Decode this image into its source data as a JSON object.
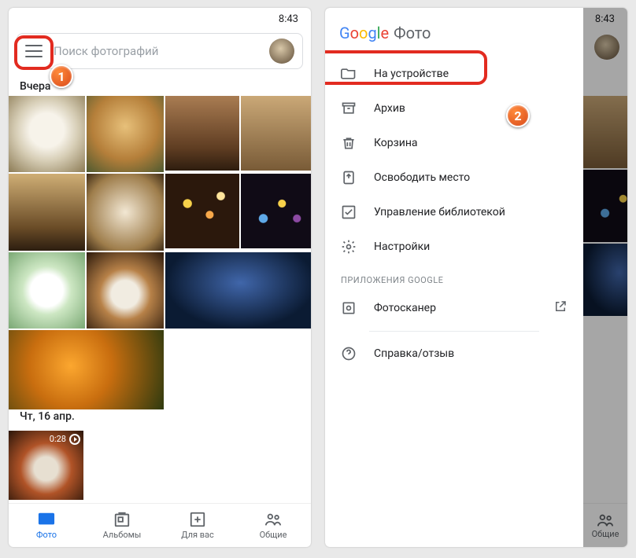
{
  "time": "8:43",
  "search": {
    "placeholder": "Поиск фотографий"
  },
  "sections": {
    "yesterday": "Вчера",
    "thu16": "Чт, 16 апр."
  },
  "video": {
    "duration": "0:28"
  },
  "tabs": {
    "photos": "Фото",
    "albums": "Альбомы",
    "foryou": "Для вас",
    "shared": "Общие"
  },
  "drawer": {
    "brand_word": "Фото",
    "items": {
      "device": "На устройстве",
      "archive": "Архив",
      "trash": "Корзина",
      "free": "Освободить место",
      "manage": "Управление библиотекой",
      "settings": "Настройки"
    },
    "apps_label": "ПРИЛОЖЕНИЯ GOOGLE",
    "photoscan": "Фотосканер",
    "help": "Справка/отзыв"
  },
  "badges": {
    "one": "1",
    "two": "2"
  }
}
